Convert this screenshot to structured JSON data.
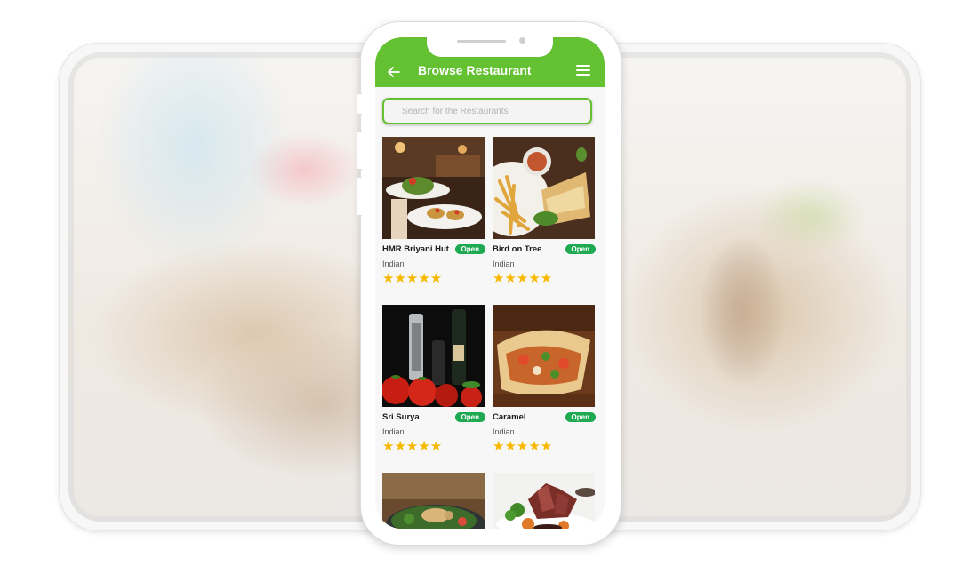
{
  "app": {
    "title": "Browse Restaurant",
    "back_icon": "arrow-left-icon",
    "menu_icon": "hamburger-menu-icon"
  },
  "search": {
    "placeholder": "Search for the Restaurants",
    "value": ""
  },
  "restaurants": [
    {
      "name": "HMR Briyani Hut",
      "status": "Open",
      "cuisine": "Indian",
      "rating": 5,
      "stars": "★★★★★",
      "image": "plated-dish-restaurant"
    },
    {
      "name": "Bird on Tree",
      "status": "Open",
      "cuisine": "Indian",
      "rating": 5,
      "stars": "★★★★★",
      "image": "sandwich-fries-dip"
    },
    {
      "name": "Sri Surya",
      "status": "Open",
      "cuisine": "Indian",
      "rating": 5,
      "stars": "★★★★★",
      "image": "tomatoes-bottles"
    },
    {
      "name": "Caramel",
      "status": "Open",
      "cuisine": "Indian",
      "rating": 5,
      "stars": "★★★★★",
      "image": "burrito-wrap"
    },
    {
      "name": "",
      "status": "",
      "cuisine": "",
      "rating": null,
      "stars": "",
      "image": "salad-bowl"
    },
    {
      "name": "",
      "status": "",
      "cuisine": "",
      "rating": null,
      "stars": "",
      "image": "sliced-steak"
    }
  ],
  "colors": {
    "brand_green": "#63c132",
    "open_badge": "#1fa952",
    "star": "#f7b900"
  }
}
